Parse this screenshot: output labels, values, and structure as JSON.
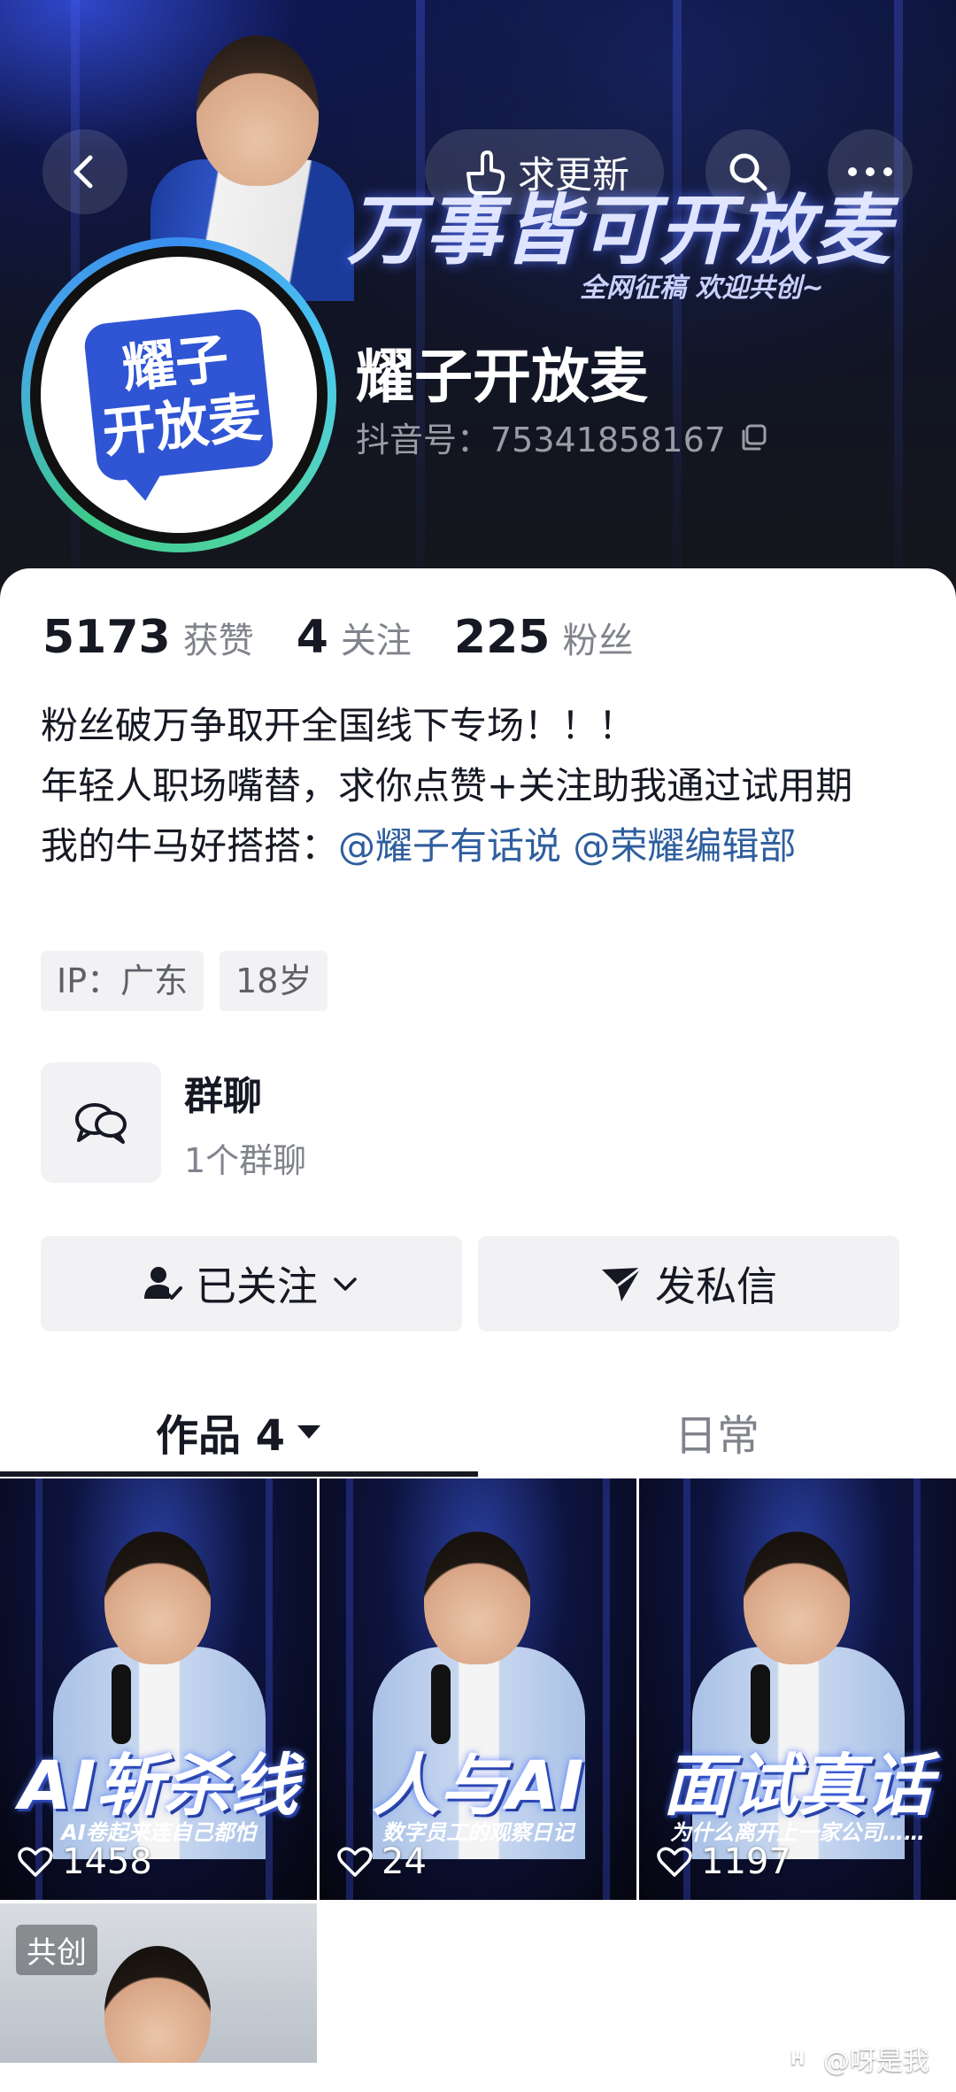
{
  "header": {
    "request_update_label": "求更新",
    "banner_title": "万事皆可开放麦",
    "banner_subtitle": "全网征稿 欢迎共创~"
  },
  "profile": {
    "avatar_line1": "耀子",
    "avatar_line2": "开放麦",
    "nickname": "耀子开放麦",
    "douyin_id": "抖音号：75341858167"
  },
  "stats": {
    "likes_count": "5173",
    "likes_label": "获赞",
    "following_count": "4",
    "following_label": "关注",
    "followers_count": "225",
    "followers_label": "粉丝"
  },
  "bio": {
    "line1": "粉丝破万争取开全国线下专场！！！",
    "line2": "年轻人职场嘴替，求你点赞+关注助我通过试用期",
    "line3_prefix": "我的牛马好搭搭：",
    "mention1": "@耀子有话说",
    "mention2": "@荣耀编辑部"
  },
  "tags": {
    "ip": "IP：广东",
    "age": "18岁"
  },
  "group_chat": {
    "title": "群聊",
    "subtitle": "1个群聊"
  },
  "actions": {
    "followed_label": "已关注",
    "message_label": "发私信"
  },
  "tabs": {
    "works_label": "作品 4",
    "daily_label": "日常"
  },
  "videos": [
    {
      "caption": "AI斩杀线",
      "subcaption": "AI卷起来连自己都怕",
      "likes": "1458"
    },
    {
      "caption": "人与AI",
      "subcaption": "数字员工的观察日记",
      "likes": "24"
    },
    {
      "caption": "面试真话",
      "subcaption": "为什么离开上一家公司……",
      "likes": "1197"
    },
    {
      "badge": "共创"
    }
  ],
  "watermark": "@呀是我",
  "colors": {
    "mention_blue": "#2e5e9e",
    "text_primary": "#161823",
    "text_secondary": "#80838c",
    "button_bg": "#f2f2f4"
  }
}
